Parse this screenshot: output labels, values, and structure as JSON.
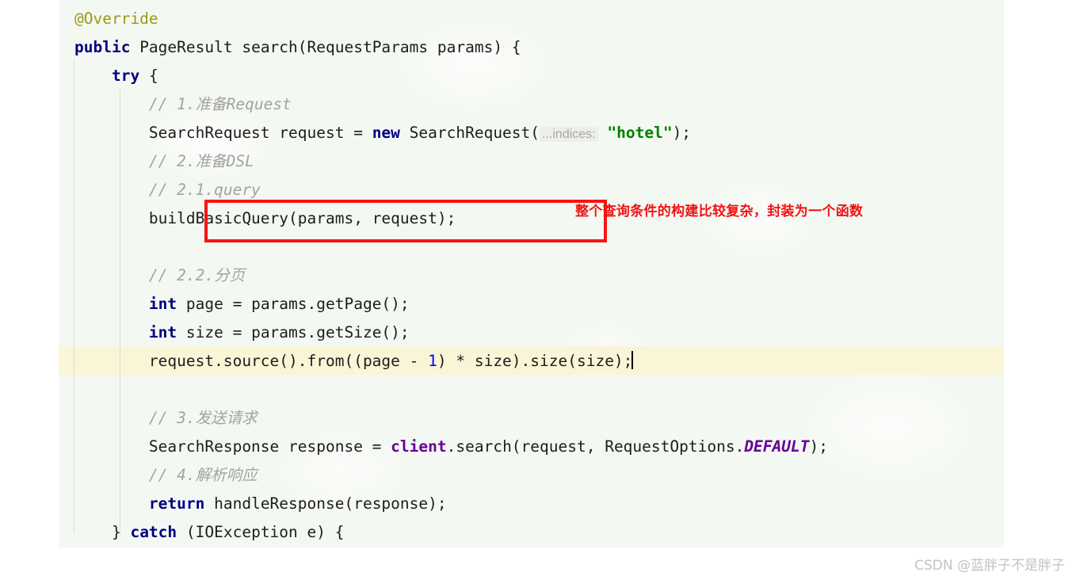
{
  "editor": {
    "language": "java",
    "background_color": "#f4f8f2",
    "caret_line_color": "#fbf5d8",
    "code_lines": [
      {
        "id": "line-override",
        "indent": 0,
        "tokens": [
          {
            "t": "annotation",
            "v": "@Override"
          }
        ]
      },
      {
        "id": "line-method-signature",
        "indent": 0,
        "tokens": [
          {
            "t": "keyword",
            "v": "public"
          },
          {
            "t": "plain",
            "v": " PageResult search(RequestParams params) {"
          }
        ]
      },
      {
        "id": "line-try",
        "indent": 1,
        "tokens": [
          {
            "t": "keyword",
            "v": "try"
          },
          {
            "t": "plain",
            "v": " {"
          }
        ]
      },
      {
        "id": "line-comment-1",
        "indent": 2,
        "tokens": [
          {
            "t": "comment",
            "v": "// 1.准备Request"
          }
        ]
      },
      {
        "id": "line-search-request",
        "indent": 2,
        "tokens": [
          {
            "t": "plain",
            "v": "SearchRequest request = "
          },
          {
            "t": "keyword",
            "v": "new"
          },
          {
            "t": "plain",
            "v": " SearchRequest("
          },
          {
            "t": "paramhint",
            "v": "...indices:"
          },
          {
            "t": "plain",
            "v": " "
          },
          {
            "t": "string",
            "v": "\"hotel\""
          },
          {
            "t": "plain",
            "v": ");"
          }
        ]
      },
      {
        "id": "line-comment-2",
        "indent": 2,
        "tokens": [
          {
            "t": "comment",
            "v": "// 2.准备DSL"
          }
        ]
      },
      {
        "id": "line-comment-2-1",
        "indent": 2,
        "tokens": [
          {
            "t": "comment",
            "v": "// 2.1.query"
          }
        ]
      },
      {
        "id": "line-build-basic-query",
        "indent": 2,
        "tokens": [
          {
            "t": "plain",
            "v": "buildBasicQuery(params, request);"
          }
        ]
      },
      {
        "id": "line-blank-1",
        "indent": 0,
        "tokens": [
          {
            "t": "plain",
            "v": ""
          }
        ]
      },
      {
        "id": "line-comment-2-2",
        "indent": 2,
        "tokens": [
          {
            "t": "comment",
            "v": "// 2.2.分页"
          }
        ]
      },
      {
        "id": "line-int-page",
        "indent": 2,
        "tokens": [
          {
            "t": "keyword",
            "v": "int"
          },
          {
            "t": "plain",
            "v": " page = params.getPage();"
          }
        ]
      },
      {
        "id": "line-int-size",
        "indent": 2,
        "tokens": [
          {
            "t": "keyword",
            "v": "int"
          },
          {
            "t": "plain",
            "v": " size = params.getSize();"
          }
        ]
      },
      {
        "id": "line-request-source",
        "indent": 2,
        "caret_line": true,
        "tokens": [
          {
            "t": "plain",
            "v": "request.source().from((page - "
          },
          {
            "t": "number",
            "v": "1"
          },
          {
            "t": "plain",
            "v": ") * size).size(size);"
          },
          {
            "t": "caret",
            "v": ""
          }
        ]
      },
      {
        "id": "line-blank-2",
        "indent": 0,
        "tokens": [
          {
            "t": "plain",
            "v": ""
          }
        ]
      },
      {
        "id": "line-comment-3",
        "indent": 2,
        "tokens": [
          {
            "t": "comment",
            "v": "// 3.发送请求"
          }
        ]
      },
      {
        "id": "line-search-response",
        "indent": 2,
        "tokens": [
          {
            "t": "plain",
            "v": "SearchResponse response = "
          },
          {
            "t": "field",
            "v": "client"
          },
          {
            "t": "plain",
            "v": ".search(request, RequestOptions."
          },
          {
            "t": "static",
            "v": "DEFAULT"
          },
          {
            "t": "plain",
            "v": ");"
          }
        ]
      },
      {
        "id": "line-comment-4",
        "indent": 2,
        "tokens": [
          {
            "t": "comment",
            "v": "// 4.解析响应"
          }
        ]
      },
      {
        "id": "line-return",
        "indent": 2,
        "tokens": [
          {
            "t": "keyword",
            "v": "return"
          },
          {
            "t": "plain",
            "v": " handleResponse(response);"
          }
        ]
      },
      {
        "id": "line-catch",
        "indent": 1,
        "tokens": [
          {
            "t": "plain",
            "v": "} "
          },
          {
            "t": "keyword",
            "v": "catch"
          },
          {
            "t": "plain",
            "v": " (IOException e) {"
          }
        ]
      }
    ]
  },
  "annotations": {
    "box": {
      "label": "buildBasicQuery(params, request);",
      "color": "#f51616"
    },
    "note": {
      "text": "整个查询条件的构建比较复杂，封装为一个函数",
      "color": "#f01414"
    }
  },
  "watermark": {
    "text": "CSDN @蓝胖子不是胖子",
    "color": "#c2c2c2"
  }
}
